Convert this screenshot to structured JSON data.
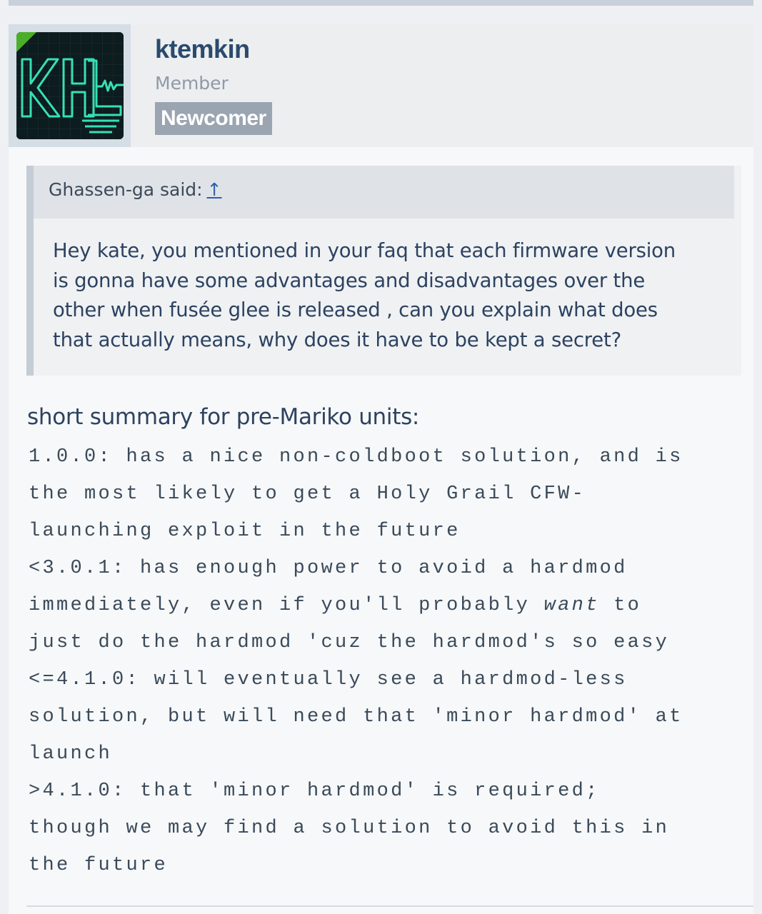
{
  "user": {
    "name": "ktemkin",
    "title": "Member",
    "badge": "Newcomer",
    "avatar_letters": "KHL"
  },
  "quote": {
    "author": "Ghassen-ga said:",
    "jump_icon": "↑",
    "lines": [
      "Hey kate, you mentioned in your faq that each firmware version",
      "is gonna have some advantages and disadvantages over the",
      "other when fusée glee is released , can you explain what does",
      "that actually means, why does it have to be kept a secret?"
    ]
  },
  "summary": {
    "heading": "short summary for pre-Mariko units:",
    "lines": [
      {
        "text": "1.0.0: has a nice non-coldboot solution, and is"
      },
      {
        "text": "the most likely to get a Holy Grail CFW-"
      },
      {
        "text": "launching exploit in the future"
      },
      {
        "text": "<3.0.1: has enough power to avoid a hardmod"
      },
      {
        "pre": "immediately, even if you'll probably ",
        "em": "want",
        "post": " to"
      },
      {
        "text": "just do the hardmod 'cuz the hardmod's so easy"
      },
      {
        "text": "<=4.1.0: will eventually see a hardmod-less"
      },
      {
        "text": "solution, but will need that 'minor hardmod' at"
      },
      {
        "text": "launch"
      },
      {
        "text": ">4.1.0: that 'minor hardmod' is required;"
      },
      {
        "text": "though we may find a solution to avoid this in"
      },
      {
        "text": "the future"
      }
    ]
  },
  "colors": {
    "username": "#2a4a6e",
    "badge_bg": "#9aa5b1",
    "avatar_neon": "#37e0b4",
    "avatar_corner": "#4caf2a"
  }
}
